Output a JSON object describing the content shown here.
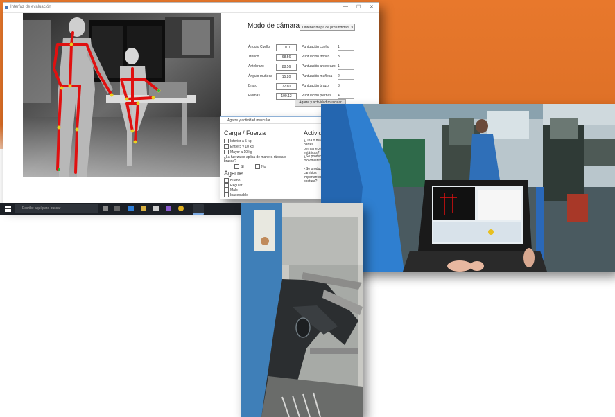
{
  "app": {
    "title": "Interfaz de evaluación",
    "win_controls": [
      "—",
      "☐",
      "✕"
    ],
    "mode_label": "Modo de cámara:",
    "mode_select": "Obtener mapa de profundidad",
    "fields_left": [
      {
        "label": "Ángulo Cuello",
        "value": "10.0"
      },
      {
        "label": "Tronco",
        "value": "68.56"
      },
      {
        "label": "Antebrazo",
        "value": "88.56"
      },
      {
        "label": "Ángulo muñeca",
        "value": "15.20"
      },
      {
        "label": "Brazo",
        "value": "72.60"
      },
      {
        "label": "Piernas",
        "value": "190.12"
      }
    ],
    "fields_right": [
      {
        "label": "Puntuación cuello",
        "value": "1"
      },
      {
        "label": "Puntuación tronco",
        "value": "3"
      },
      {
        "label": "Puntuación antebrazo",
        "value": "1"
      },
      {
        "label": "Puntuación muñeca",
        "value": "2"
      },
      {
        "label": "Puntuación brazo",
        "value": "3"
      },
      {
        "label": "Puntuación piernas",
        "value": "4"
      }
    ],
    "add_button": "Agarre y actividad muscular"
  },
  "dialog": {
    "title": "Agarre y actividad muscular",
    "load_title": "Carga / Fuerza",
    "load_options": [
      "Inferior a 5 kg",
      "Entre 5 y 10 kg",
      "Mayor a 10 kg"
    ],
    "question": "¿La fuerza se aplica de manera rápida o brusca?",
    "yes": "Sí",
    "no": "No",
    "grip_title": "Agarre",
    "grip_options": [
      "Bueno",
      "Regular",
      "Malo",
      "Inaceptable"
    ],
    "activity_title": "Actividad",
    "activity_questions": [
      "¿Una o más partes permanecen estáticas?",
      "¿Se producen movimientos?",
      "¿Se producen cambios importantes de postura?"
    ]
  },
  "taskbar": {
    "search_placeholder": "Escribe aquí para buscar"
  },
  "colors": {
    "orange": "#e8782c",
    "skeleton": "#e01010",
    "joint": "#e8d020",
    "taskbar": "#1c2026"
  }
}
